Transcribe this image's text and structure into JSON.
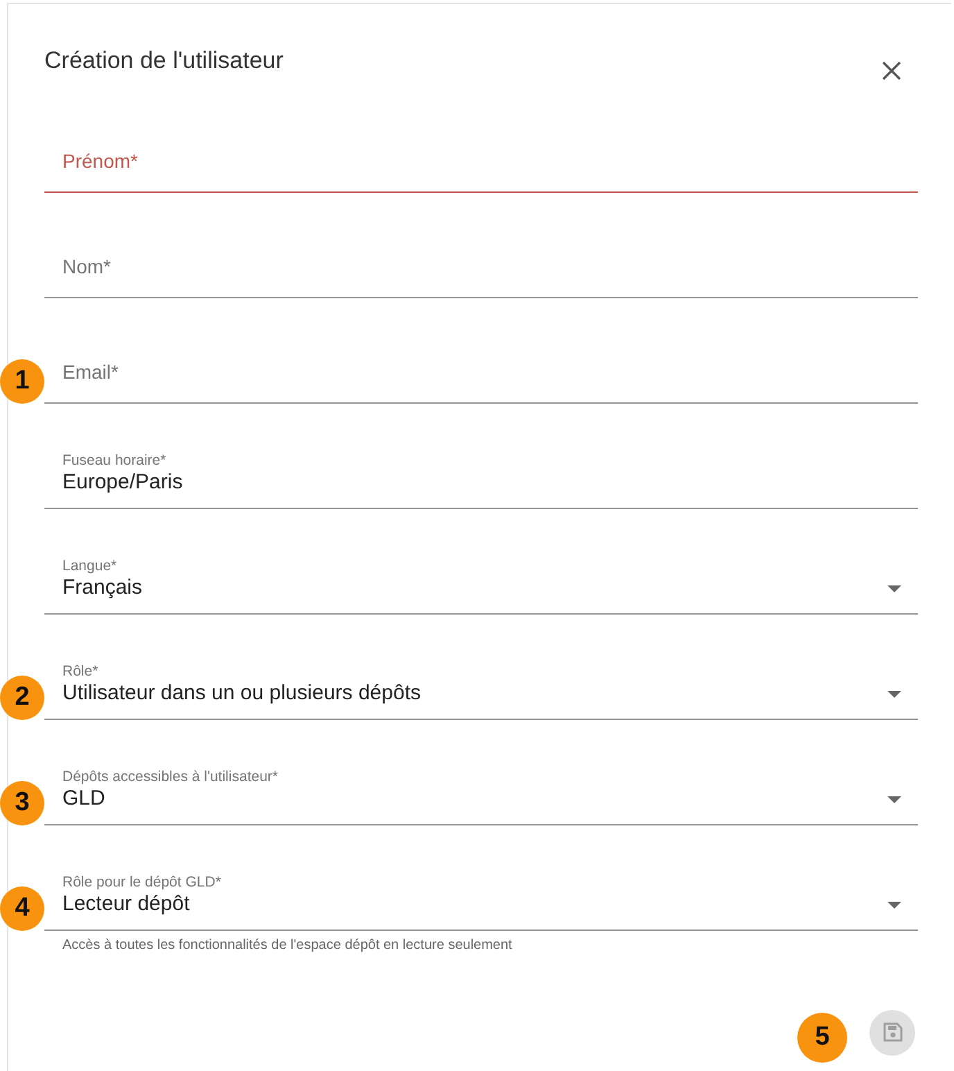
{
  "dialog": {
    "title": "Création de l'utilisateur"
  },
  "fields": [
    {
      "kind": "text",
      "label": "Prénom*",
      "error": true
    },
    {
      "kind": "text",
      "label": "Nom*",
      "error": false
    },
    {
      "kind": "text",
      "label": "Email*",
      "error": false,
      "callout": "1"
    },
    {
      "kind": "text",
      "label": "Fuseau horaire*",
      "value": "Europe/Paris",
      "error": false
    },
    {
      "kind": "select",
      "label": "Langue*",
      "value": "Français",
      "error": false
    },
    {
      "kind": "select",
      "label": "Rôle*",
      "value": "Utilisateur dans un ou plusieurs dépôts",
      "error": false,
      "callout": "2"
    },
    {
      "kind": "select",
      "label": "Dépôts accessibles à l'utilisateur*",
      "value": "GLD",
      "error": false,
      "callout": "3"
    },
    {
      "kind": "select",
      "label": "Rôle pour le dépôt GLD*",
      "value": "Lecteur dépôt",
      "error": false,
      "callout": "4",
      "helper": "Accès à toutes les fonctionnalités de l'espace dépôt en lecture seulement"
    }
  ],
  "save_button": {
    "disabled": true,
    "callout": "5"
  }
}
